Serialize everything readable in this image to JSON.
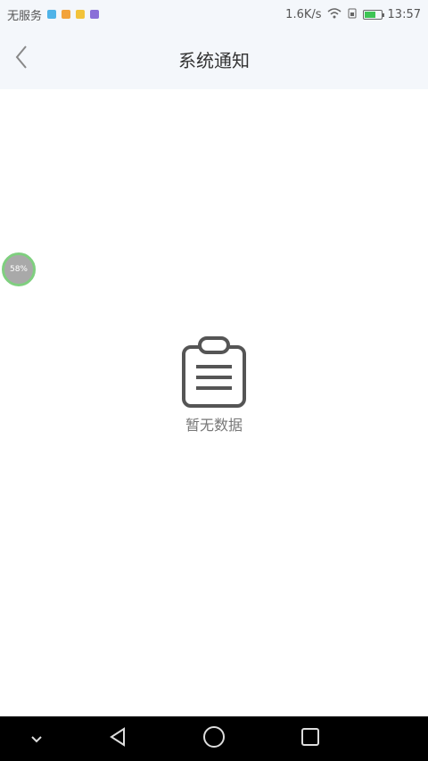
{
  "status_bar": {
    "carrier": "无服务",
    "network_speed": "1.6K/s",
    "time": "13:57",
    "battery_level_fraction": 0.6,
    "notification_colors": [
      "#4fb3e8",
      "#f2a33a",
      "#f2c33a",
      "#8a6fd8"
    ]
  },
  "nav": {
    "title": "系统通知",
    "back_icon": "chevron-left-icon"
  },
  "floating_badge": {
    "text": "58%"
  },
  "empty_state": {
    "icon": "clipboard-icon",
    "text": "暂无数据"
  },
  "system_nav": {
    "buttons": [
      "collapse-icon",
      "back-triangle-icon",
      "home-circle-icon",
      "recents-square-icon"
    ]
  }
}
